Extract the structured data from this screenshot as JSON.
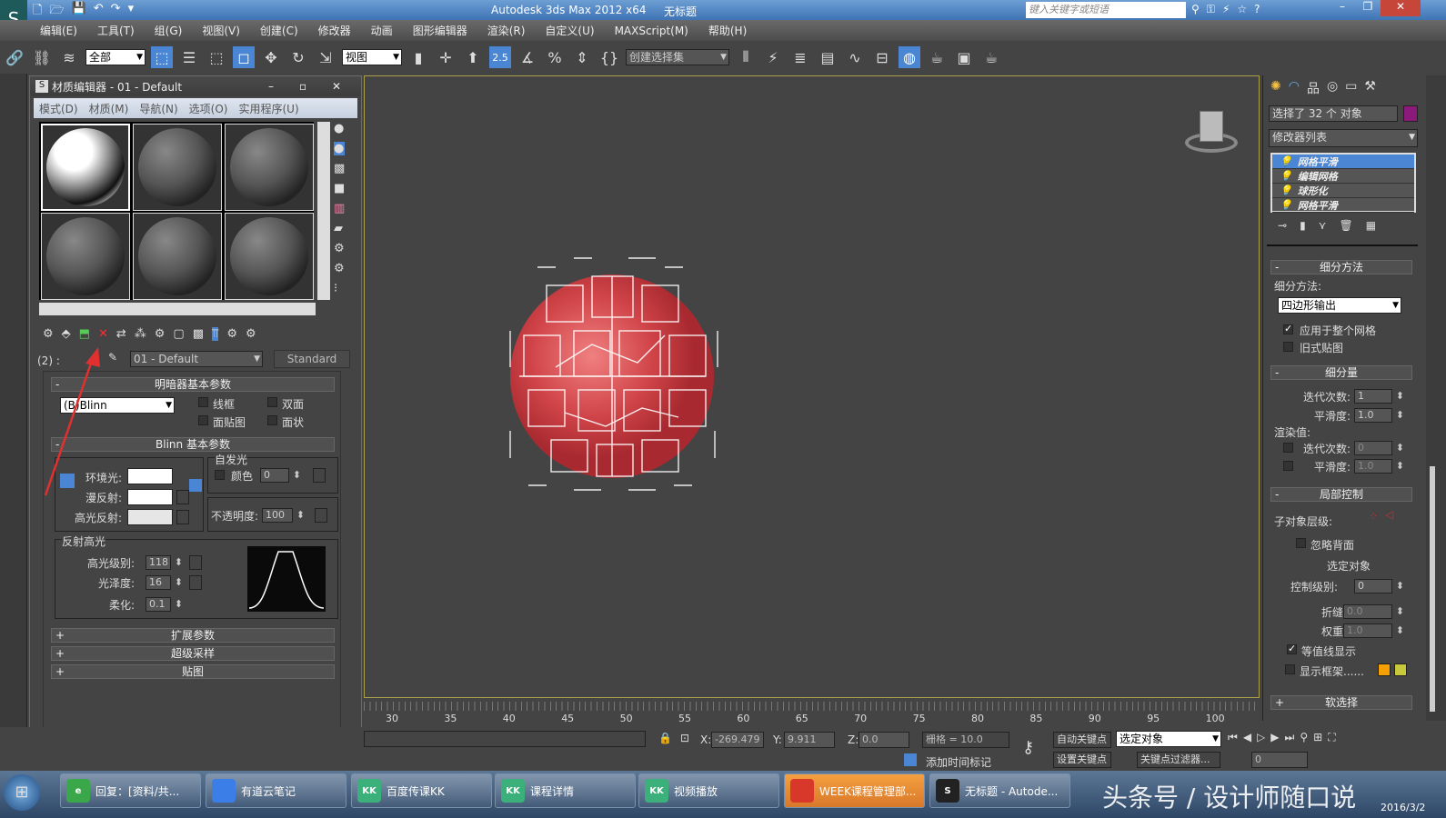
{
  "app": {
    "title": "Autodesk 3ds Max  2012 x64",
    "doc_title": "无标题",
    "search_placeholder": "键入关键字或短语"
  },
  "menu": [
    "编辑(E)",
    "工具(T)",
    "组(G)",
    "视图(V)",
    "创建(C)",
    "修改器",
    "动画",
    "图形编辑器",
    "渲染(R)",
    "自定义(U)",
    "MAXScript(M)",
    "帮助(H)"
  ],
  "toolbar": {
    "filter": "全部",
    "ref_coord": "视图",
    "snap_value": "2.5",
    "named_selection": "创建选择集"
  },
  "material_editor": {
    "title": "材质编辑器 - 01 - Default",
    "menu": [
      "模式(D)",
      "材质(M)",
      "导航(N)",
      "选项(O)",
      "实用程序(U)"
    ],
    "slot_label": "(2) :",
    "material_name": "01 - Default",
    "material_type": "Standard",
    "shader_rollout": {
      "title": "明暗器基本参数",
      "shader": "(B)Blinn",
      "wire": "线框",
      "two_sided": "双面",
      "face_map": "面贴图",
      "faceted": "面状"
    },
    "blinn_rollout": {
      "title": "Blinn 基本参数",
      "ambient": "环境光:",
      "diffuse": "漫反射:",
      "specular": "高光反射:",
      "self_illum": "自发光",
      "color": "颜色",
      "color_value": "0",
      "opacity": "不透明度:",
      "opacity_value": "100",
      "spec_highlights": "反射高光",
      "spec_level": "高光级别:",
      "spec_level_value": "118",
      "glossiness": "光泽度:",
      "glossiness_value": "16",
      "soften": "柔化:",
      "soften_value": "0.1"
    },
    "collapsed_rollouts": [
      "扩展参数",
      "超级采样",
      "贴图"
    ]
  },
  "command_panel": {
    "selection": "选择了 32 个 对象",
    "object_color": "#8b1a7a",
    "modifier_list": "修改器列表",
    "stack": [
      "网格平滑",
      "编辑网格",
      "球形化",
      "网格平滑"
    ],
    "subdiv_method": {
      "title": "细分方法",
      "label": "细分方法:",
      "value": "四边形输出",
      "apply_whole": "应用于整个网格",
      "old_mapping": "旧式贴图",
      "apply_whole_checked": true,
      "old_mapping_checked": false
    },
    "subdiv_amount": {
      "title": "细分量",
      "iterations": "迭代次数:",
      "iterations_value": "1",
      "smoothness": "平滑度:",
      "smoothness_value": "1.0",
      "render_values": "渲染值:",
      "r_iterations_value": "0",
      "r_smoothness_value": "1.0"
    },
    "local_control": {
      "title": "局部控制",
      "sublevel": "子对象层级:",
      "ignore_backface": "忽略背面",
      "selected": "选定对象",
      "control_level": "控制级别:",
      "control_level_value": "0",
      "crease": "折缝:",
      "crease_value": "0.0",
      "weight": "权重:",
      "weight_value": "1.0",
      "isoline": "等值线显示",
      "isoline_checked": true,
      "show_cage": "显示框架......",
      "cage_colors": [
        "#f5a000",
        "#c8c83c"
      ]
    },
    "soft_selection": "软选择"
  },
  "timeline": {
    "ticks": [
      "30",
      "35",
      "40",
      "45",
      "50",
      "55",
      "60",
      "65",
      "70",
      "75",
      "80",
      "85",
      "90",
      "95",
      "100"
    ]
  },
  "status": {
    "x_label": "X:",
    "x": "-269.479",
    "y_label": "Y:",
    "y": "9.911",
    "z_label": "Z:",
    "z": "0.0",
    "grid": "栅格 = 10.0",
    "auto_key": "自动关键点",
    "set_key": "设置关键点",
    "key_mode": "选定对象",
    "key_filters": "关键点过滤器...",
    "add_time_tag": "添加时间标记",
    "frame": "0"
  },
  "taskbar": {
    "items": [
      {
        "label": "回复：[资料/共...",
        "icon_color": "#3aa84a",
        "icon_text": "e"
      },
      {
        "label": "有道云笔记",
        "icon_color": "#3b7ee8",
        "icon_text": ""
      },
      {
        "label": "百度传课KK",
        "icon_color": "#3bb07a",
        "icon_text": "KK"
      },
      {
        "label": "课程详情",
        "icon_color": "#3bb07a",
        "icon_text": "KK"
      },
      {
        "label": "视频播放",
        "icon_color": "#3bb07a",
        "icon_text": "KK"
      },
      {
        "label": "WEEK课程管理部...",
        "icon_color": "#d8382a",
        "icon_text": ""
      },
      {
        "label": "无标题 - Autode...",
        "icon_color": "#222",
        "icon_text": "S"
      }
    ],
    "date": "2016/3/2",
    "watermark": "头条号 / 设计师随口说"
  }
}
